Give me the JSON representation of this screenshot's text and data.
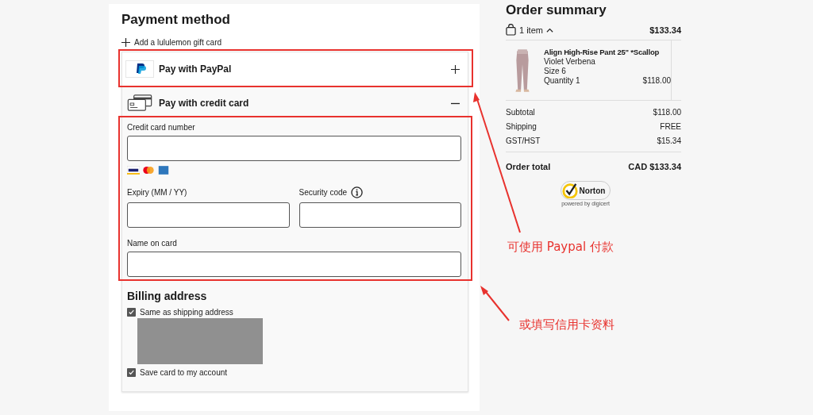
{
  "payment": {
    "title": "Payment method",
    "gift_card_link": "Add a lululemon gift card",
    "methods": [
      {
        "kind": "paypal",
        "label": "Pay with PayPal",
        "expanded": false
      },
      {
        "kind": "card",
        "label": "Pay with credit card",
        "expanded": true
      }
    ],
    "fields": [
      {
        "label": "Credit card number"
      },
      {
        "label": "Expiry (MM / YY)",
        "info": false
      },
      {
        "label": "Security code",
        "info": true
      },
      {
        "label": "Name on card"
      }
    ],
    "billing": {
      "title": "Billing address",
      "options": [
        {
          "label": "Same as shipping address",
          "checked": true
        },
        {
          "label": "Save card to my account",
          "checked": true
        }
      ]
    }
  },
  "summary": {
    "title": "Order summary",
    "item_count": "1 item",
    "header_total": "$133.34",
    "item": {
      "name": "Align High-Rise Pant 25\" *Scallop",
      "variant": "Violet Verbena",
      "size": "Size 6",
      "quantity": "Quantity 1",
      "price": "$118.00"
    },
    "lines": [
      {
        "label": "Subtotal",
        "value": "$118.00"
      },
      {
        "label": "Shipping",
        "value": "FREE"
      },
      {
        "label": "GST/HST",
        "value": "$15.34"
      }
    ],
    "total_label": "Order total",
    "total_value": "CAD $133.34",
    "badge": {
      "name": "Norton",
      "caption": "powered by digicert"
    }
  },
  "annotations": [
    {
      "text": "可使用 Paypal 付款"
    },
    {
      "text": "或填写信用卡资料"
    }
  ]
}
